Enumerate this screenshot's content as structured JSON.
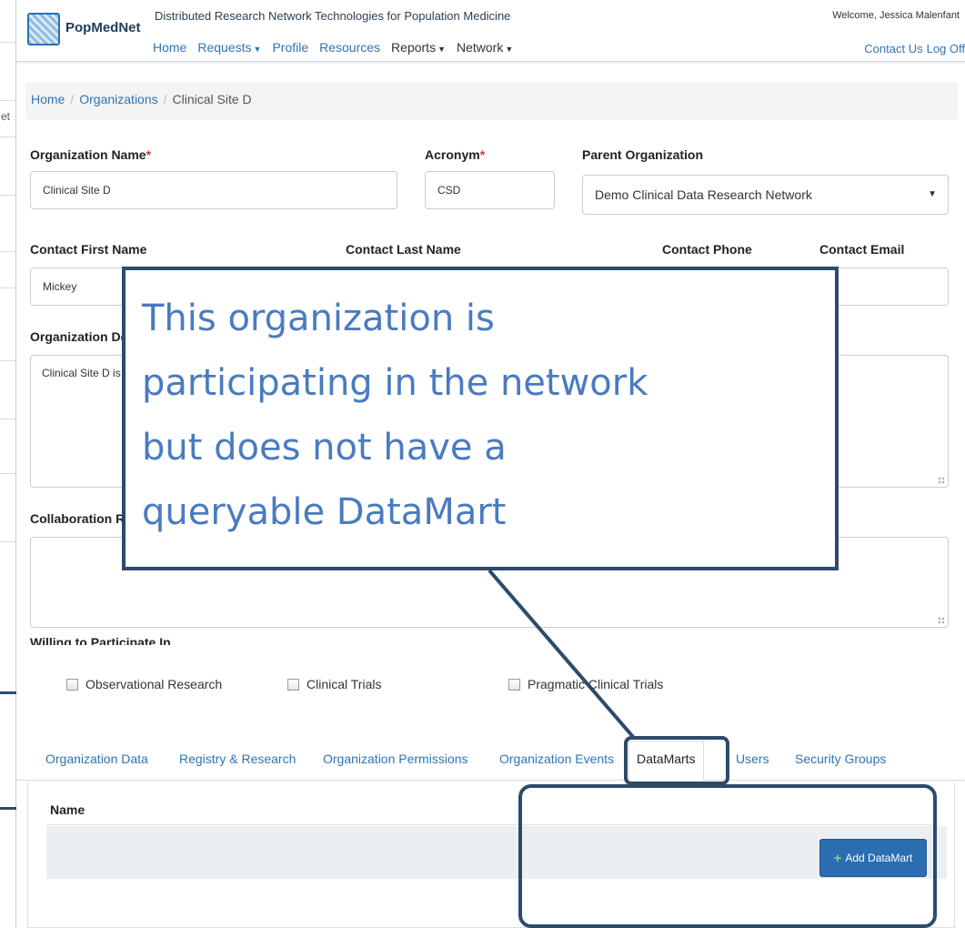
{
  "header": {
    "logo_text": "PopMedNet",
    "tagline": "Distributed Research Network Technologies for Population Medicine",
    "welcome": "Welcome, Jessica Malenfant",
    "nav": [
      {
        "label": "Home",
        "caret": false
      },
      {
        "label": "Requests",
        "caret": true
      },
      {
        "label": "Profile",
        "caret": false
      },
      {
        "label": "Resources",
        "caret": false
      },
      {
        "label": "Reports",
        "caret": true
      },
      {
        "label": "Network",
        "caret": true
      }
    ],
    "contact_us": "Contact Us",
    "log_off": "Log Off"
  },
  "background": {
    "fragment": "et"
  },
  "breadcrumb": {
    "home": "Home",
    "organizations": "Organizations",
    "current": "Clinical Site D"
  },
  "form": {
    "org_name_label": "Organization Name",
    "org_name_value": "Clinical Site D",
    "acronym_label": "Acronym",
    "acronym_value": "CSD",
    "parent_label": "Parent Organization",
    "parent_value": "Demo Clinical Data Research Network",
    "contact_first_label": "Contact First Name",
    "contact_first_value": "Mickey",
    "contact_last_label": "Contact Last Name",
    "contact_phone_label": "Contact Phone",
    "contact_email_label": "Contact Email",
    "org_desc_label_visible": "Organization De",
    "org_desc_value_visible": "Clinical Site D is",
    "collab_label_visible": "Collaboration R",
    "willing_label": "Willing to Participate In",
    "required_mark": "*"
  },
  "participation": [
    {
      "label": "Observational Research",
      "checked": false
    },
    {
      "label": "Clinical Trials",
      "checked": false
    },
    {
      "label": "Pragmatic Clinical Trials",
      "checked": false
    }
  ],
  "tabs": [
    {
      "label": "Organization Data",
      "active": false
    },
    {
      "label": "Registry & Research",
      "active": false
    },
    {
      "label": "Organization Permissions",
      "active": false
    },
    {
      "label": "Organization Events",
      "active": false
    },
    {
      "label": "DataMarts",
      "active": true
    },
    {
      "label": "Users",
      "active": false
    },
    {
      "label": "Security Groups",
      "active": false
    }
  ],
  "grid": {
    "name_header": "Name",
    "add_button": "Add DataMart"
  },
  "callout": {
    "lines": [
      "This organization is",
      "participating in the network",
      "but does not have a",
      "queryable DataMart"
    ]
  },
  "colors": {
    "accent": "#2f74b5",
    "callout_border": "#2e4a6b",
    "callout_text": "#4a7bbf",
    "required": "#d9342b",
    "button": "#2a6db0"
  }
}
